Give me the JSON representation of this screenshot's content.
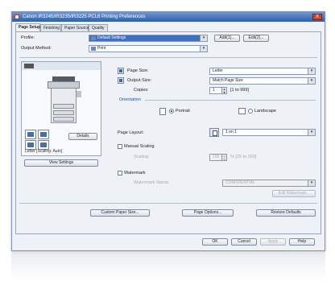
{
  "window": {
    "title": "Canon iR3245/iR3235/iR3225 PCL6 Printing Preferences",
    "close_label": "X"
  },
  "tabs": [
    {
      "label": "Page Setup"
    },
    {
      "label": "Finishing"
    },
    {
      "label": "Paper Source"
    },
    {
      "label": "Quality"
    }
  ],
  "profile": {
    "label": "Profile:",
    "value": "Default Settings",
    "add_label": "Add(1)...",
    "edit_label": "Edit(2)..."
  },
  "output_method": {
    "label": "Output Method:",
    "value": "Print"
  },
  "page_size": {
    "label": "Page Size:",
    "value": "Letter"
  },
  "output_size": {
    "label": "Output Size:",
    "value": "Match Page Size"
  },
  "copies": {
    "label": "Copies:",
    "value": "1",
    "range": "[1 to 999]"
  },
  "orientation": {
    "label": "Orientation",
    "portrait": "Portrait",
    "landscape": "Landscape"
  },
  "page_layout": {
    "label": "Page Layout:",
    "value": "1 on 1"
  },
  "manual_scaling": {
    "label": "Manual Scaling",
    "scaling_label": "Scaling:",
    "scaling_value": "100",
    "scaling_range": "% [25 to 200]"
  },
  "watermark": {
    "label": "Watermark",
    "name_label": "Watermark Name:",
    "name_value": "CONFIDENTIAL",
    "edit_label": "Edit Watermark..."
  },
  "preview": {
    "mode_label": "Details",
    "caption": "Letter [Scaling: Auto]",
    "view_settings": "View Settings"
  },
  "footer": {
    "custom_paper": "Custom Paper Size...",
    "page_options": "Page Options...",
    "restore": "Restore Defaults"
  },
  "dialog": {
    "ok": "OK",
    "cancel": "Cancel",
    "apply": "Apply",
    "help": "Help"
  }
}
